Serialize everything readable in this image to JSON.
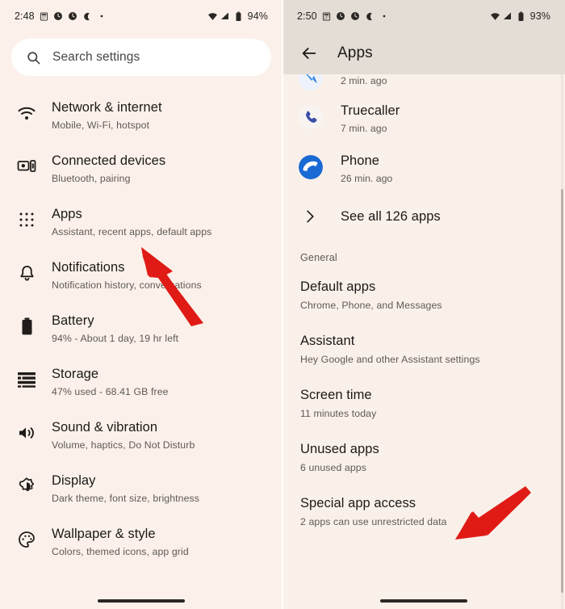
{
  "left_screen": {
    "status_bar": {
      "time": "2:48",
      "battery_percent": "94%",
      "icons": [
        "calculator-icon",
        "clock-icon",
        "clock-icon",
        "moon-icon",
        "dot-icon",
        "wifi-icon",
        "signal-icon",
        "battery-icon"
      ]
    },
    "search": {
      "placeholder": "Search settings",
      "icon": "search-icon"
    },
    "items": [
      {
        "icon": "wifi-icon",
        "title": "Network & internet",
        "subtitle": "Mobile, Wi-Fi, hotspot"
      },
      {
        "icon": "devices-icon",
        "title": "Connected devices",
        "subtitle": "Bluetooth, pairing"
      },
      {
        "icon": "apps-grid-icon",
        "title": "Apps",
        "subtitle": "Assistant, recent apps, default apps"
      },
      {
        "icon": "bell-icon",
        "title": "Notifications",
        "subtitle": "Notification history, conversations"
      },
      {
        "icon": "battery-icon",
        "title": "Battery",
        "subtitle": "94% - About 1 day, 19 hr left"
      },
      {
        "icon": "storage-icon",
        "title": "Storage",
        "subtitle": "47% used - 68.41 GB free"
      },
      {
        "icon": "volume-icon",
        "title": "Sound & vibration",
        "subtitle": "Volume, haptics, Do Not Disturb"
      },
      {
        "icon": "brightness-icon",
        "title": "Display",
        "subtitle": "Dark theme, font size, brightness"
      },
      {
        "icon": "palette-icon",
        "title": "Wallpaper & style",
        "subtitle": "Colors, themed icons, app grid"
      }
    ]
  },
  "right_screen": {
    "status_bar": {
      "time": "2:50",
      "battery_percent": "93%"
    },
    "app_bar": {
      "back_icon": "arrow-back-icon",
      "title": "Apps"
    },
    "recent_apps": [
      {
        "icon": "app-icon-partial",
        "name": "",
        "time": "2 min. ago"
      },
      {
        "icon": "truecaller-icon",
        "name": "Truecaller",
        "time": "7 min. ago"
      },
      {
        "icon": "phone-icon",
        "name": "Phone",
        "time": "26 min. ago"
      }
    ],
    "see_all": {
      "label": "See all 126 apps",
      "icon": "chevron-right-icon"
    },
    "section_label": "General",
    "general_items": [
      {
        "title": "Default apps",
        "subtitle": "Chrome, Phone, and Messages"
      },
      {
        "title": "Assistant",
        "subtitle": "Hey Google and other Assistant settings"
      },
      {
        "title": "Screen time",
        "subtitle": "11 minutes today"
      },
      {
        "title": "Unused apps",
        "subtitle": "6 unused apps"
      },
      {
        "title": "Special app access",
        "subtitle": "2 apps can use unrestricted data"
      }
    ]
  },
  "annotations": {
    "arrow_color": "#e01b16",
    "arrows": [
      {
        "name": "arrow-pointing-to-apps",
        "target": "Apps"
      },
      {
        "name": "arrow-pointing-to-special-app-access",
        "target": "Special app access"
      }
    ]
  },
  "colors": {
    "page_background": "#faf0ea",
    "status_bar_right": "#e4ddd5",
    "search_field": "#ffffff",
    "primary_text": "#1b1917",
    "secondary_text": "#5e5954",
    "accent_red": "#e01b16"
  }
}
